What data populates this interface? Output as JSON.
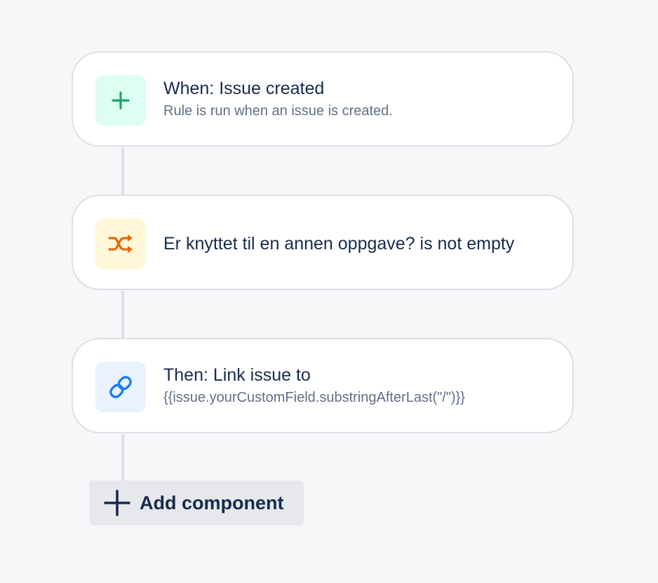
{
  "colors": {
    "background": "#f6f7f9",
    "card_border": "#dcdfe4",
    "title_text": "#172b4d",
    "subtitle_text": "#626f86",
    "trigger_icon": "#22a06b",
    "condition_icon": "#e56910",
    "action_icon": "#1d7afc"
  },
  "components": [
    {
      "type": "trigger",
      "icon": "plus-icon",
      "title": "When: Issue created",
      "subtitle": "Rule is run when an issue is created."
    },
    {
      "type": "condition",
      "icon": "branch-shuffle-icon",
      "title": "Er knyttet til en annen oppgave? is not empty",
      "subtitle": ""
    },
    {
      "type": "action",
      "icon": "link-icon",
      "title": "Then: Link issue to",
      "subtitle": "{{issue.yourCustomField.substringAfterLast(\"/\")}}"
    }
  ],
  "add_component": {
    "icon": "plus-icon",
    "label": "Add component"
  }
}
